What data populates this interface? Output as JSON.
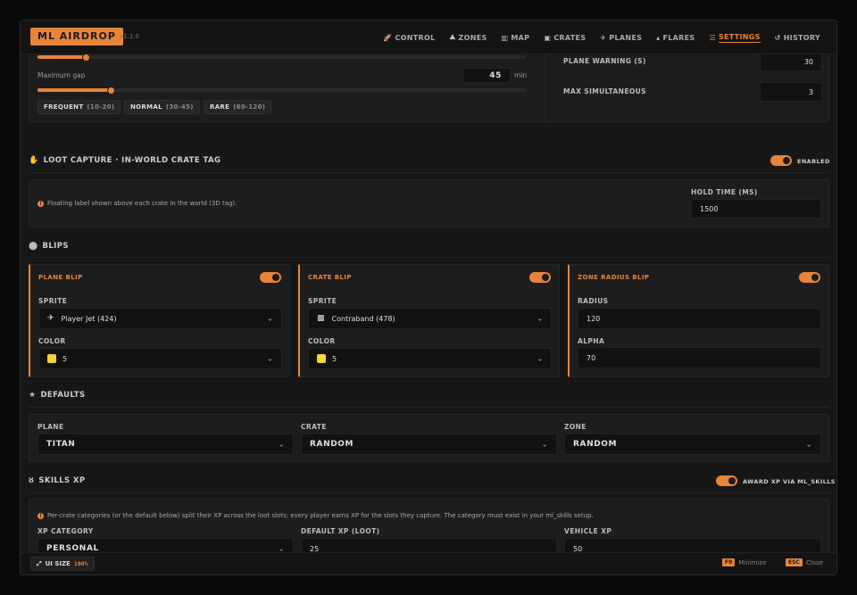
{
  "app": {
    "logo": "ML AIRDROP",
    "version": "v1.1.0"
  },
  "nav": [
    {
      "icon": "🚀",
      "label": "CONTROL",
      "active": false
    },
    {
      "icon": "⛰",
      "label": "ZONES",
      "active": false
    },
    {
      "icon": "▥",
      "label": "MAP",
      "active": false
    },
    {
      "icon": "▣",
      "label": "CRATES",
      "active": false
    },
    {
      "icon": "✈",
      "label": "PLANES",
      "active": false
    },
    {
      "icon": "▴",
      "label": "FLARES",
      "active": false
    },
    {
      "icon": "☰",
      "label": "SETTINGS",
      "active": true
    },
    {
      "icon": "↺",
      "label": "HISTORY",
      "active": false
    }
  ],
  "schedule": {
    "min_gap_fraction": 0.1,
    "max_gap_label": "Maximum gap",
    "max_gap_value": "45",
    "max_gap_unit": "min",
    "max_gap_fraction": 0.15,
    "presets": [
      {
        "name": "FREQUENT",
        "range": "(10-20)"
      },
      {
        "name": "NORMAL",
        "range": "(30-45)"
      },
      {
        "name": "RARE",
        "range": "(60-120)"
      }
    ],
    "plane_warning_label": "PLANE WARNING (S)",
    "plane_warning_value": "30",
    "max_simultaneous_label": "MAX SIMULTANEOUS",
    "max_simultaneous_value": "3"
  },
  "loot_capture": {
    "title": "LOOT CAPTURE · IN-WORLD CRATE TAG",
    "toggle_label": "ENABLED",
    "info": "Floating label shown above each crate in the world (3D tag).",
    "hold_time_label": "HOLD TIME (MS)",
    "hold_time_value": "1500"
  },
  "blips": {
    "title": "BLIPS",
    "plane": {
      "title": "PLANE BLIP",
      "sprite_label": "SPRITE",
      "sprite_value": "Player Jet (424)",
      "color_label": "COLOR",
      "color_value": "5"
    },
    "crate": {
      "title": "CRATE BLIP",
      "sprite_label": "SPRITE",
      "sprite_value": "Contraband (478)",
      "color_label": "COLOR",
      "color_value": "5"
    },
    "zone": {
      "title": "ZONE RADIUS BLIP",
      "radius_label": "RADIUS",
      "radius_value": "120",
      "alpha_label": "ALPHA",
      "alpha_value": "70"
    },
    "swatch_color": "#f5d33a"
  },
  "defaults": {
    "title": "DEFAULTS",
    "plane_label": "PLANE",
    "plane_value": "TITAN",
    "crate_label": "CRATE",
    "crate_value": "RANDOM",
    "zone_label": "ZONE",
    "zone_value": "RANDOM"
  },
  "skills": {
    "title": "SKILLS XP",
    "toggle_label": "AWARD XP VIA ML_SKILLS",
    "info": "Per-crate categories (or the default below) split their XP across the loot slots; every player earns XP for the slots they capture. The category must exist in your ml_skills setup.",
    "category_label": "XP CATEGORY",
    "category_value": "PERSONAL",
    "default_xp_label": "DEFAULT XP (LOOT)",
    "default_xp_value": "25",
    "vehicle_xp_label": "VEHICLE XP",
    "vehicle_xp_value": "50"
  },
  "footer": {
    "ui_size_label": "UI SIZE",
    "ui_size_value": "100%",
    "minimize_key": "F9",
    "minimize_label": "Minimize",
    "close_key": "ESC",
    "close_label": "Close"
  },
  "colors": {
    "accent": "#e8843a",
    "background": "#171717"
  }
}
